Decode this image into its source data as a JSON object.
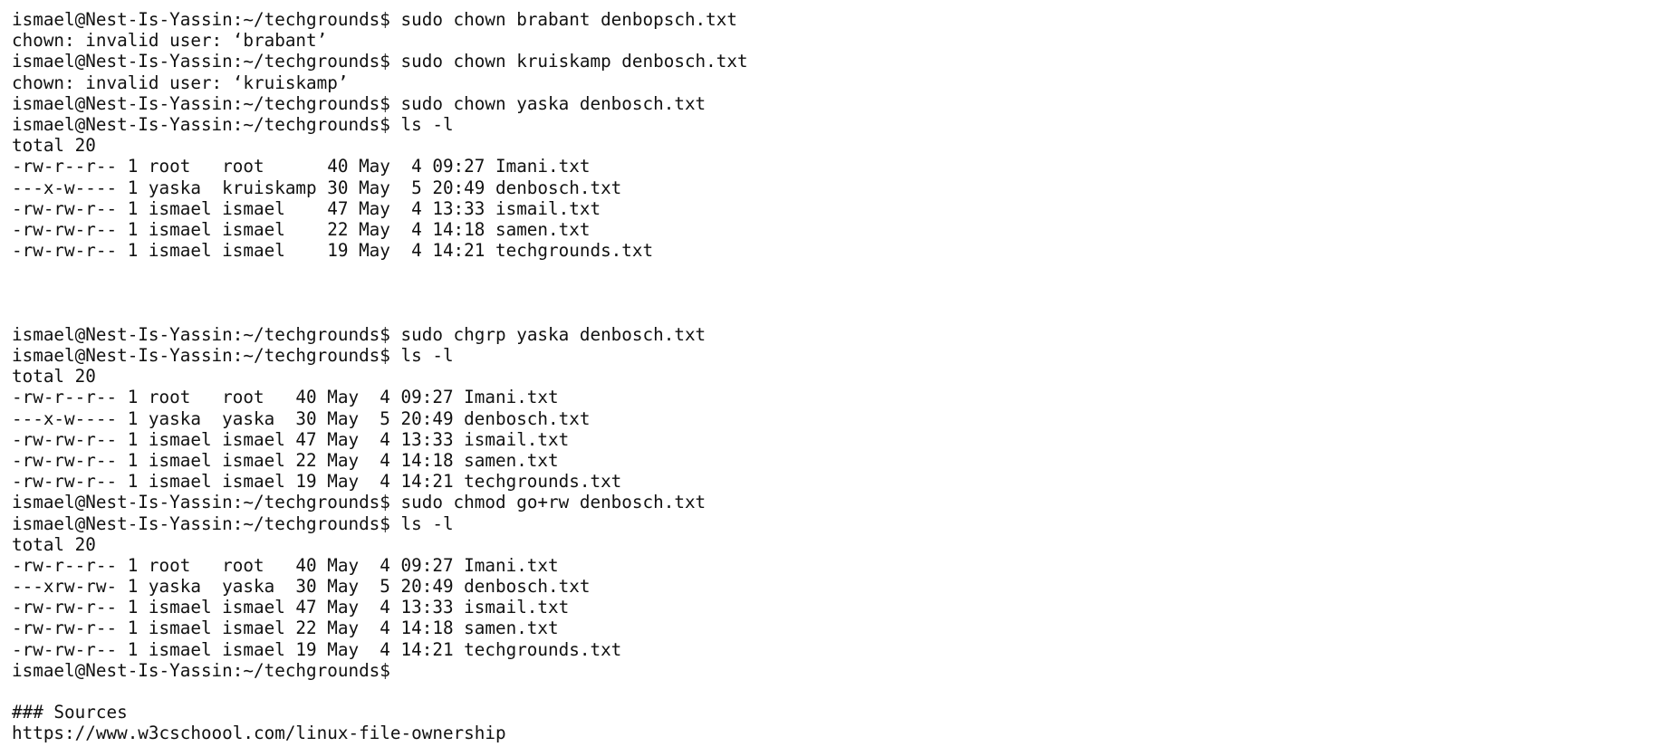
{
  "terminal": {
    "lines": [
      {
        "prompt": "ismael@Nest-Is-Yassin:~/techgrounds$",
        "command": " sudo chown brabant denbopsch.txt"
      },
      {
        "text": "chown: invalid user: ‘brabant’"
      },
      {
        "prompt": "ismael@Nest-Is-Yassin:~/techgrounds$",
        "command": " sudo chown kruiskamp denbosch.txt"
      },
      {
        "text": "chown: invalid user: ‘kruiskamp’"
      },
      {
        "prompt": "ismael@Nest-Is-Yassin:~/techgrounds$",
        "command": " sudo chown yaska denbosch.txt"
      },
      {
        "prompt": "ismael@Nest-Is-Yassin:~/techgrounds$",
        "command": " ls -l"
      },
      {
        "text": "total 20"
      },
      {
        "text": "-rw-r--r-- 1 root   root      40 May  4 09:27 Imani.txt"
      },
      {
        "text": "---x-w---- 1 yaska  kruiskamp 30 May  5 20:49 denbosch.txt"
      },
      {
        "text": "-rw-rw-r-- 1 ismael ismael    47 May  4 13:33 ismail.txt"
      },
      {
        "text": "-rw-rw-r-- 1 ismael ismael    22 May  4 14:18 samen.txt"
      },
      {
        "text": "-rw-rw-r-- 1 ismael ismael    19 May  4 14:21 techgrounds.txt"
      },
      {
        "text": ""
      },
      {
        "text": ""
      },
      {
        "text": ""
      },
      {
        "prompt": "ismael@Nest-Is-Yassin:~/techgrounds$",
        "command": " sudo chgrp yaska denbosch.txt"
      },
      {
        "prompt": "ismael@Nest-Is-Yassin:~/techgrounds$",
        "command": " ls -l"
      },
      {
        "text": "total 20"
      },
      {
        "text": "-rw-r--r-- 1 root   root   40 May  4 09:27 Imani.txt"
      },
      {
        "text": "---x-w---- 1 yaska  yaska  30 May  5 20:49 denbosch.txt"
      },
      {
        "text": "-rw-rw-r-- 1 ismael ismael 47 May  4 13:33 ismail.txt"
      },
      {
        "text": "-rw-rw-r-- 1 ismael ismael 22 May  4 14:18 samen.txt"
      },
      {
        "text": "-rw-rw-r-- 1 ismael ismael 19 May  4 14:21 techgrounds.txt"
      },
      {
        "prompt": "ismael@Nest-Is-Yassin:~/techgrounds$",
        "command": " sudo chmod go+rw denbosch.txt"
      },
      {
        "prompt": "ismael@Nest-Is-Yassin:~/techgrounds$",
        "command": " ls -l"
      },
      {
        "text": "total 20"
      },
      {
        "text": "-rw-r--r-- 1 root   root   40 May  4 09:27 Imani.txt"
      },
      {
        "text": "---xrw-rw- 1 yaska  yaska  30 May  5 20:49 denbosch.txt"
      },
      {
        "text": "-rw-rw-r-- 1 ismael ismael 47 May  4 13:33 ismail.txt"
      },
      {
        "text": "-rw-rw-r-- 1 ismael ismael 22 May  4 14:18 samen.txt"
      },
      {
        "text": "-rw-rw-r-- 1 ismael ismael 19 May  4 14:21 techgrounds.txt"
      },
      {
        "prompt": "ismael@Nest-Is-Yassin:~/techgrounds$",
        "command": ""
      },
      {
        "text": ""
      },
      {
        "text": "### Sources"
      },
      {
        "link": "https://www.w3cschoool.com/linux-file-ownership"
      }
    ]
  }
}
